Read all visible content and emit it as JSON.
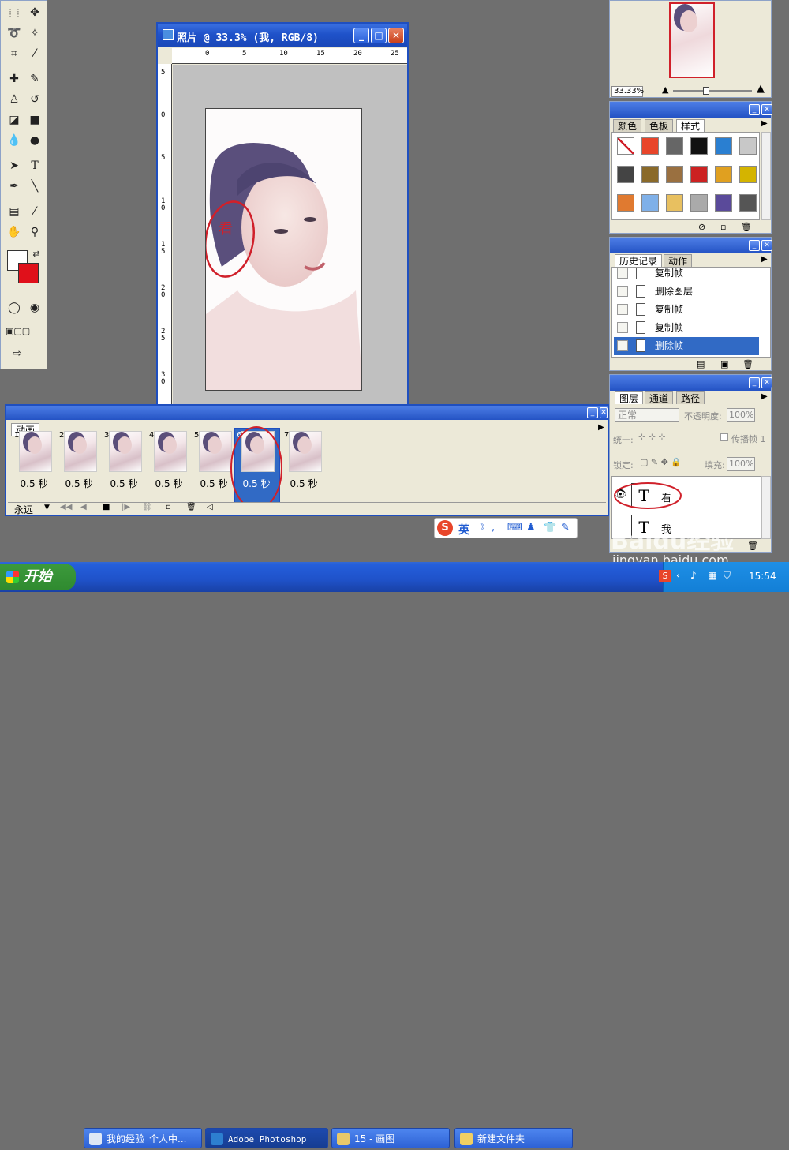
{
  "document_window": {
    "title": "照片 @ 33.3% (我, RGB/8)",
    "ruler_h": [
      "0",
      "5",
      "10",
      "15",
      "20",
      "25"
    ],
    "ruler_v": [
      "5",
      "0",
      "5",
      "1 0",
      "1 5",
      "2 0",
      "2 5",
      "3 0"
    ],
    "annotation": "看"
  },
  "navigator": {
    "zoom": "33.33%"
  },
  "swatch_panel": {
    "tabs": [
      "颜色",
      "色板",
      "样式"
    ],
    "swatch_colors": [
      "#ffffff",
      "#e8452a",
      "#666666",
      "#111111",
      "#2a7fd1",
      "#c8c8c8",
      "#444444",
      "#8a6a2a",
      "#9a7040",
      "#cc2222",
      "#e0a020",
      "#d4b400",
      "#e07a30",
      "#7fb0e8",
      "#e8c060",
      "#aaaaaa",
      "#5a4a9a",
      "#555555"
    ]
  },
  "history_panel": {
    "tabs": [
      "历史记录",
      "动作"
    ],
    "items": [
      "复制帧",
      "删除图层",
      "复制帧",
      "复制帧",
      "删除帧"
    ],
    "selected_index": 4
  },
  "layers_panel": {
    "tabs": [
      "图层",
      "通道",
      "路径"
    ],
    "blend_mode": "正常",
    "opacity_label": "不透明度:",
    "opacity": "100%",
    "unify_label": "统一:",
    "propagate_label": "传播帧 1",
    "lock_label": "锁定:",
    "fill_label": "填充:",
    "fill": "100%",
    "layers": [
      {
        "name": "看",
        "glyph": "T"
      },
      {
        "name": "我",
        "glyph": "T"
      }
    ]
  },
  "animation_panel": {
    "tab": "动画",
    "frames": [
      {
        "num": "1",
        "delay": "0.5 秒"
      },
      {
        "num": "2",
        "delay": "0.5 秒"
      },
      {
        "num": "3",
        "delay": "0.5 秒"
      },
      {
        "num": "4",
        "delay": "0.5 秒"
      },
      {
        "num": "5",
        "delay": "0.5 秒"
      },
      {
        "num": "6",
        "delay": "0.5 秒"
      },
      {
        "num": "7",
        "delay": "0.5 秒"
      }
    ],
    "selected_frame": 5,
    "loop": "永远"
  },
  "ime_bar": {
    "logo": "S",
    "lang": "英"
  },
  "taskbar": {
    "start": "开始",
    "tasks": [
      "我的经验_个人中...",
      "Adobe Photoshop",
      "15 - 画图",
      "新建文件夹"
    ],
    "clock": "15:54"
  },
  "watermark": {
    "site": "jingyan.baidu.com",
    "brand": "Baidu经验"
  },
  "colors": {
    "foreground": "#ffffff",
    "background": "#e0101a",
    "selection": "#316ac5",
    "title_blue": "#2453c4",
    "annotation_red": "#d0202a"
  }
}
